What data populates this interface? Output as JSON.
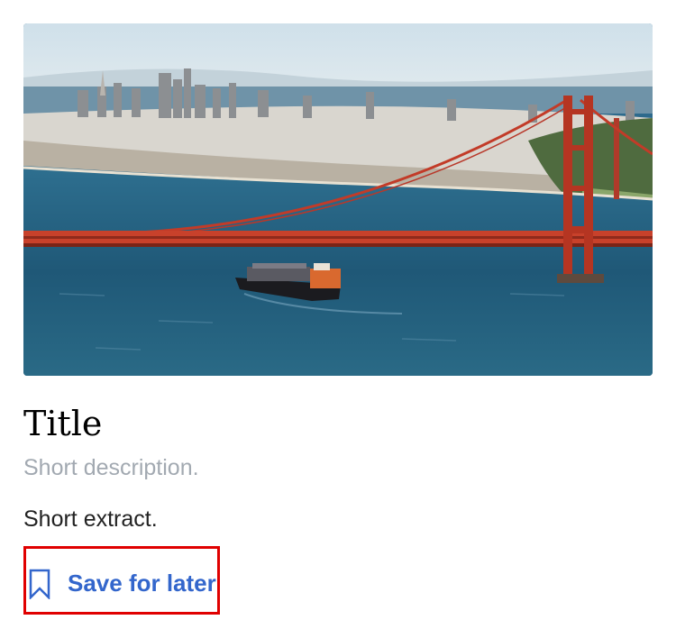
{
  "card": {
    "image_alt": "Golden Gate Bridge with San Francisco skyline",
    "title": "Title",
    "description": "Short description.",
    "extract": "Short extract.",
    "save_label": "Save for later",
    "save_icon": "bookmark-icon"
  },
  "colors": {
    "title": "#000000",
    "description": "#a2a9b1",
    "extract": "#222222",
    "link": "#3366cc",
    "highlight_border": "#e00000"
  }
}
